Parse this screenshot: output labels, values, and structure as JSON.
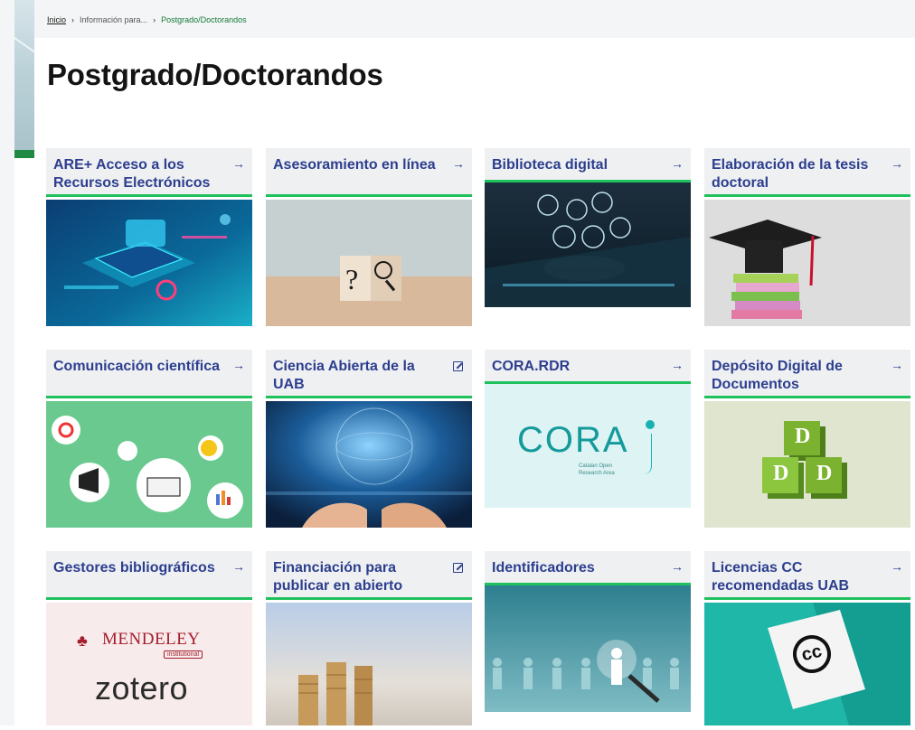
{
  "breadcrumb": {
    "home": "Inicio",
    "middle": "Información para...",
    "current": "Postgrado/Doctorandos"
  },
  "page_title": "Postgrado/Doctorandos",
  "cards": [
    {
      "label": "ARE+ Acceso a los Recursos Electrónicos",
      "icon": "arrow-right-icon",
      "image": "electronic-resources-laptop-image"
    },
    {
      "label": "Asesoramiento en línea",
      "icon": "arrow-right-icon",
      "image": "question-magnifier-blocks-image"
    },
    {
      "label": "Biblioteca digital",
      "icon": "arrow-right-icon",
      "image": "digital-library-keyboard-image"
    },
    {
      "label": "Elaboración de la tesis doctoral",
      "icon": "arrow-right-icon",
      "image": "graduation-cap-books-image"
    },
    {
      "label": "Comunicación científica",
      "icon": "arrow-right-icon",
      "image": "science-communication-icons-image"
    },
    {
      "label": "Ciencia Abierta de la UAB",
      "icon": "external-link-icon",
      "image": "globe-hands-image"
    },
    {
      "label": "CORA.RDR",
      "icon": "arrow-right-icon",
      "image": "cora-logo-image"
    },
    {
      "label": "Depósito Digital de Documentos",
      "icon": "arrow-right-icon",
      "image": "ddd-blocks-image"
    },
    {
      "label": "Gestores bibliográficos",
      "icon": "arrow-right-icon",
      "image": "mendeley-zotero-logos-image"
    },
    {
      "label": "Financiación para publicar en abierto",
      "icon": "external-link-icon",
      "image": "coin-stacks-image"
    },
    {
      "label": "Identificadores",
      "icon": "arrow-right-icon",
      "image": "identified-person-image"
    },
    {
      "label": "Licencias CC recomendadas UAB",
      "icon": "arrow-right-icon",
      "image": "creative-commons-card-image"
    }
  ],
  "thumb_text": {
    "cora_word": "CORA",
    "cora_sub_1": "Catalan Open",
    "cora_sub_2": "Research Area",
    "ddd_letter": "D",
    "mendeley_word": "MENDELEY",
    "mendeley_tag": "institutional",
    "zotero_word": "zotero",
    "cc_word": "cc",
    "question_mark": "?"
  },
  "colors": {
    "card_title": "#2d3e8e",
    "card_header_bg": "#eef0f2",
    "accent_green": "#1fc15c",
    "breadcrumb_current": "#157a3a",
    "sidebar_green": "#1f8a43"
  }
}
